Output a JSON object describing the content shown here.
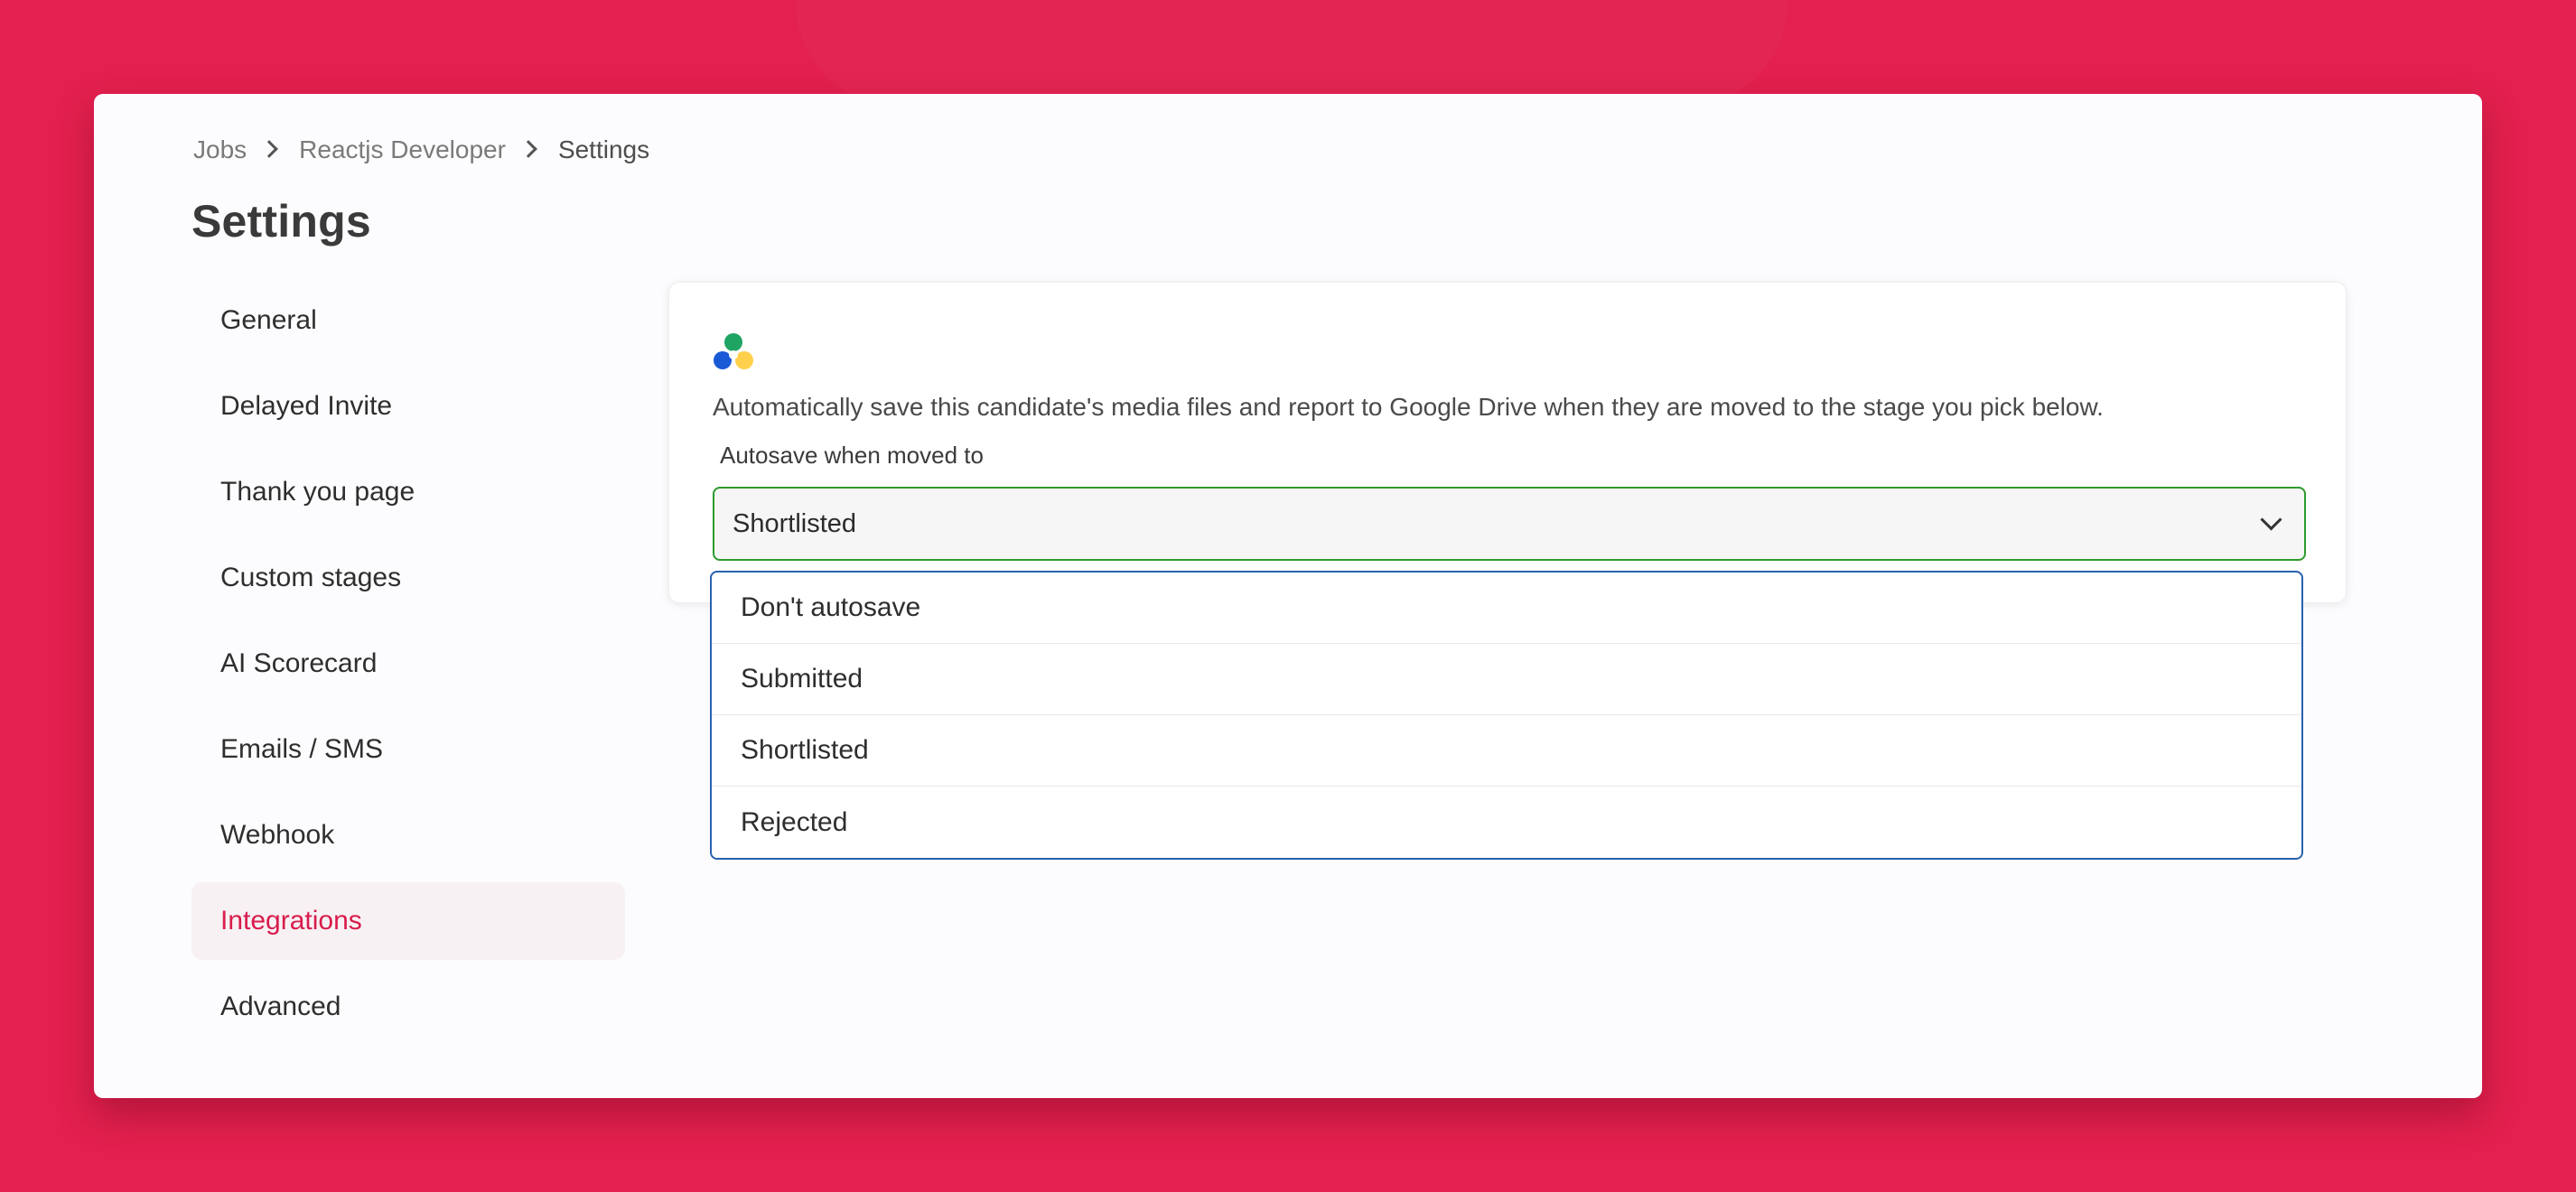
{
  "breadcrumb": {
    "items": [
      "Jobs",
      "Reactjs Developer",
      "Settings"
    ]
  },
  "page": {
    "title": "Settings"
  },
  "sidebar": {
    "items": [
      {
        "label": "General"
      },
      {
        "label": "Delayed Invite"
      },
      {
        "label": "Thank you page"
      },
      {
        "label": "Custom stages"
      },
      {
        "label": "AI Scorecard"
      },
      {
        "label": "Emails / SMS"
      },
      {
        "label": "Webhook"
      },
      {
        "label": "Integrations",
        "active": true
      },
      {
        "label": "Advanced"
      }
    ]
  },
  "integration": {
    "icon": "google-drive-icon",
    "description": "Automatically save this candidate's media files and report to Google Drive when they are moved to the stage you pick below.",
    "field_label": "Autosave when moved to",
    "selected_value": "Shortlisted",
    "options": [
      "Don't autosave",
      "Submitted",
      "Shortlisted",
      "Rejected"
    ]
  },
  "colors": {
    "background": "#e3204f",
    "accent": "#d81c4c",
    "active_nav_bg": "#f8f1f4",
    "select_border": "#2e9a2e",
    "dropdown_border": "#2a62b0"
  }
}
